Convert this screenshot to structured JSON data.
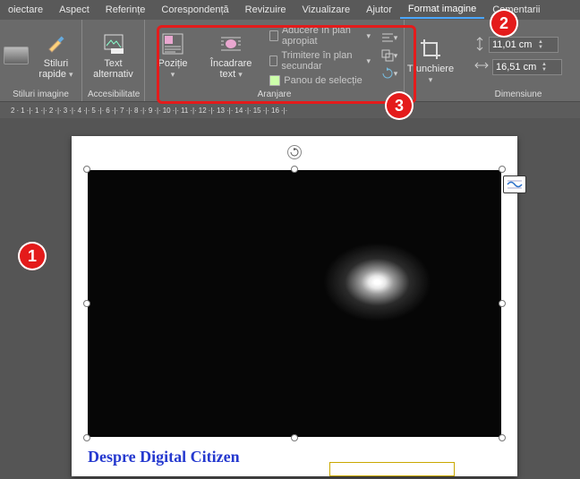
{
  "tabs": {
    "items": [
      "oiectare",
      "Aspect",
      "Referințe",
      "Corespondență",
      "Revizuire",
      "Vizualizare",
      "Ajutor",
      "Format imagine",
      "Comentarii"
    ],
    "active_index": 7
  },
  "ribbon": {
    "styles": {
      "label": "Stiluri rapide",
      "group": "Stiluri imagine"
    },
    "alttext": {
      "label": "Text alternativ",
      "group": "Accesibilitate"
    },
    "arrange": {
      "position": "Poziție",
      "wrap": "Încadrare text",
      "bring_front": "Aducere în plan apropiat",
      "send_back": "Trimitere în plan secundar",
      "selection_pane": "Panou de selecție",
      "group": "Aranjare"
    },
    "crop": {
      "label": "Trunchiere"
    },
    "size": {
      "height": "11,01 cm",
      "width": "16,51 cm",
      "group": "Dimensiune"
    }
  },
  "ruler_marks": [
    "2",
    "1",
    "",
    "1",
    "2",
    "3",
    "4",
    "5",
    "6",
    "7",
    "8",
    "9",
    "10",
    "11",
    "12",
    "13",
    "14",
    "15",
    "16",
    ""
  ],
  "doc": {
    "title": "Despre Digital Citizen"
  },
  "badges": {
    "one": "1",
    "two": "2",
    "three": "3"
  }
}
